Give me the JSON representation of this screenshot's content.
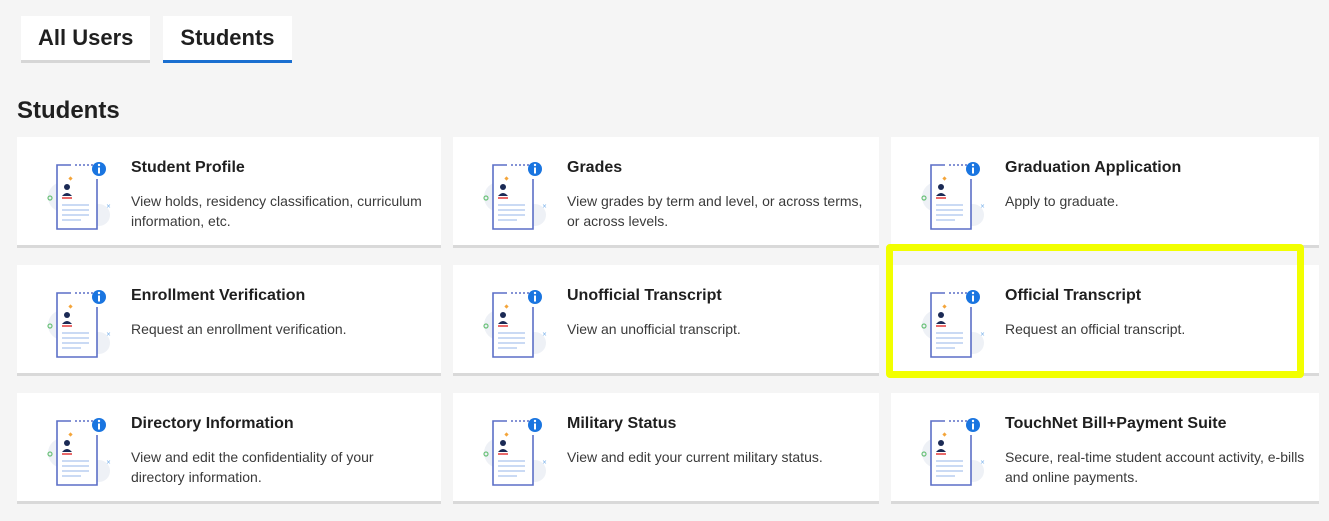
{
  "tabs": [
    {
      "label": "All Users",
      "active": false
    },
    {
      "label": "Students",
      "active": true
    }
  ],
  "section_title": "Students",
  "cards": [
    {
      "title": "Student Profile",
      "desc": "View holds, residency classification, curriculum information, etc."
    },
    {
      "title": "Grades",
      "desc": "View grades by term and level, or across terms, or across levels."
    },
    {
      "title": "Graduation Application",
      "desc": "Apply to graduate."
    },
    {
      "title": "Enrollment Verification",
      "desc": "Request an enrollment verification."
    },
    {
      "title": "Unofficial Transcript",
      "desc": "View an unofficial transcript."
    },
    {
      "title": "Official Transcript",
      "desc": "Request an official transcript."
    },
    {
      "title": "Directory Information",
      "desc": "View and edit the confidentiality of your directory information."
    },
    {
      "title": "Military Status",
      "desc": "View and edit your current military status."
    },
    {
      "title": "TouchNet Bill+Payment Suite",
      "desc": "Secure, real-time student account activity, e-bills and online payments."
    }
  ],
  "card_icon": "document-profile-icon",
  "highlight_color": "#f2ff00",
  "accent_color": "#1a6fd0"
}
